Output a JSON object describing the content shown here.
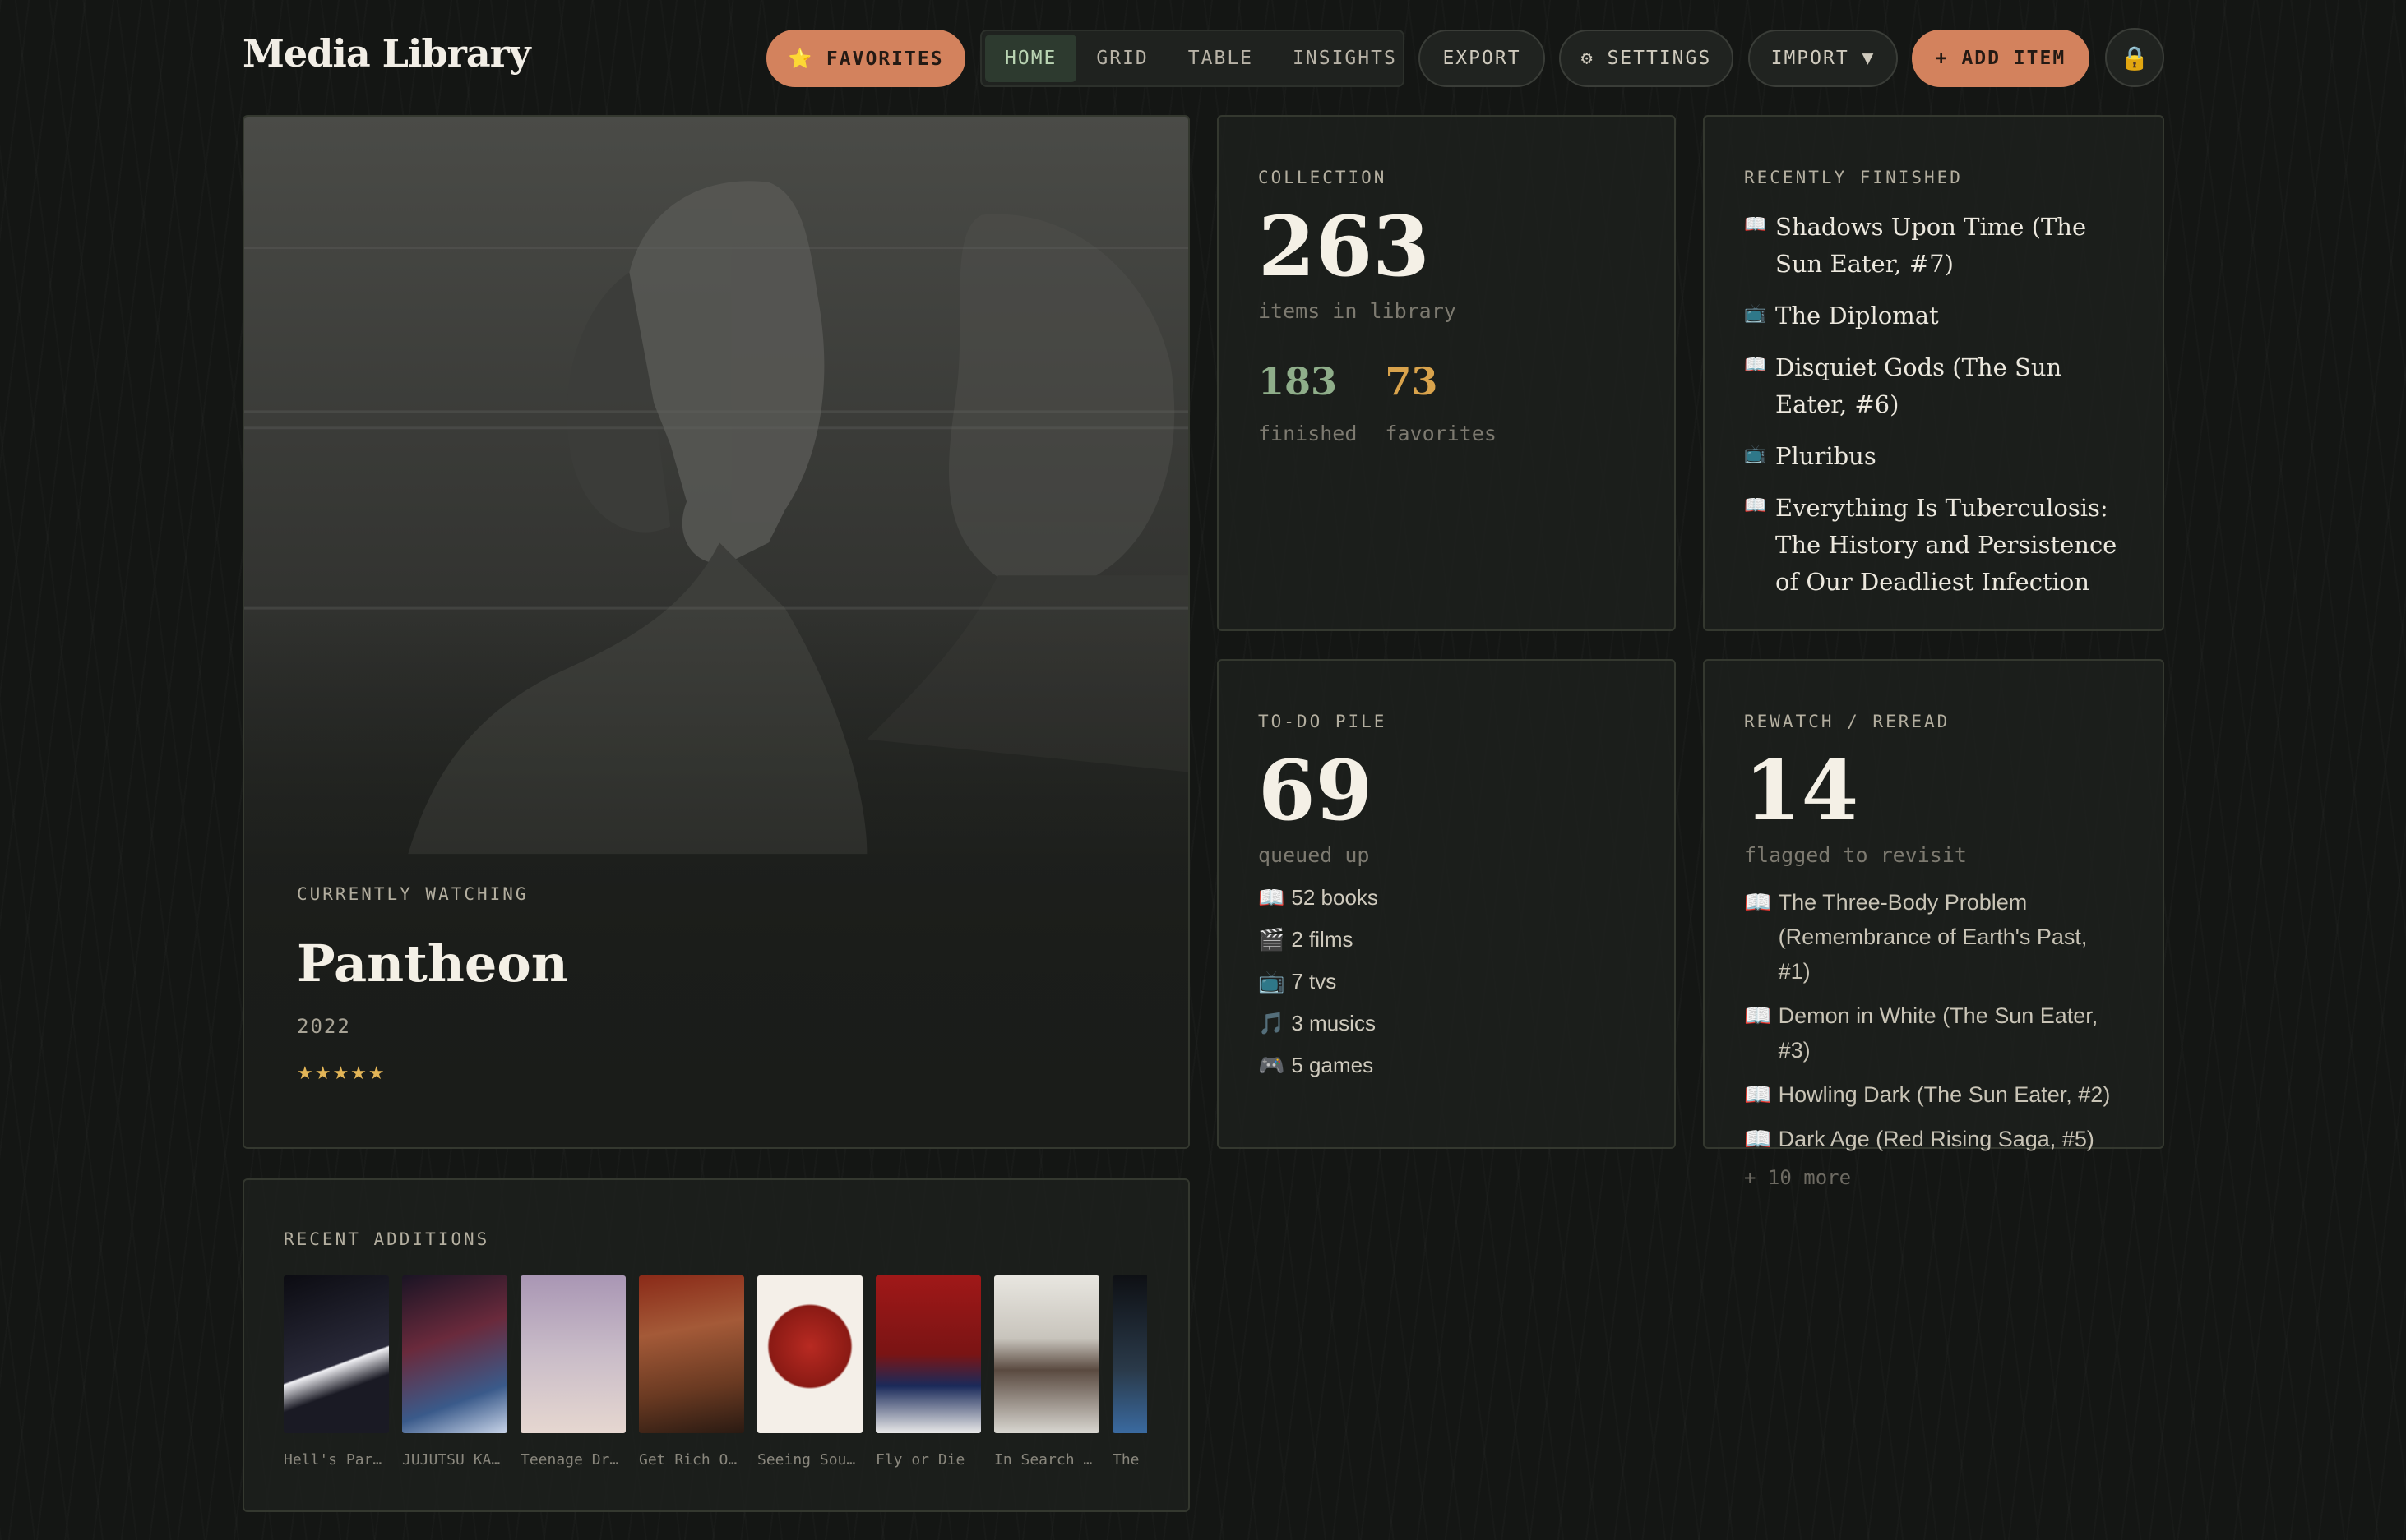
{
  "header": {
    "brand": "Media Library",
    "favorites_label": "⭐ FAVORITES",
    "tabs": [
      "HOME",
      "GRID",
      "TABLE",
      "INSIGHTS"
    ],
    "export_label": "EXPORT",
    "settings_label": "⚙ SETTINGS",
    "import_label": "IMPORT ▼",
    "add_label": "+ ADD ITEM",
    "lock_icon": "🔒"
  },
  "hero": {
    "label": "CURRENTLY WATCHING",
    "title": "Pantheon",
    "year": "2022",
    "stars": "★★★★★"
  },
  "collection": {
    "label": "COLLECTION",
    "total": "263",
    "total_sub": "items in library",
    "finished": "183",
    "finished_sub": "finished",
    "favorites": "73",
    "favorites_sub": "favorites"
  },
  "recently_finished": {
    "label": "RECENTLY FINISHED",
    "items": [
      {
        "icon": "📖",
        "title": "Shadows Upon Time (The Sun Eater, #7)"
      },
      {
        "icon": "📺",
        "title": "The Diplomat"
      },
      {
        "icon": "📖",
        "title": "Disquiet Gods (The Sun Eater, #6)"
      },
      {
        "icon": "📺",
        "title": "Pluribus"
      },
      {
        "icon": "📖",
        "title": "Everything Is Tuberculosis: The History and Persistence of Our Deadliest Infection"
      }
    ]
  },
  "todo": {
    "label": "TO-DO PILE",
    "total": "69",
    "sub": "queued up",
    "items": [
      {
        "icon": "📖",
        "text": "52 books"
      },
      {
        "icon": "🎬",
        "text": "2 films"
      },
      {
        "icon": "📺",
        "text": "7 tvs"
      },
      {
        "icon": "🎵",
        "text": "3 musics"
      },
      {
        "icon": "🎮",
        "text": "5 games"
      }
    ]
  },
  "rewatch": {
    "label": "REWATCH / REREAD",
    "total": "14",
    "sub": "flagged to revisit",
    "items": [
      {
        "icon": "📖",
        "title": "The Three-Body Problem (Remembrance of Earth's Past, #1)"
      },
      {
        "icon": "📖",
        "title": "Demon in White (The Sun Eater, #3)"
      },
      {
        "icon": "📖",
        "title": "Howling Dark (The Sun Eater, #2)"
      },
      {
        "icon": "📖",
        "title": "Dark Age (Red Rising Saga, #5)"
      }
    ],
    "more": "+ 10 more"
  },
  "recent": {
    "label": "RECENT ADDITIONS",
    "items": [
      {
        "caption": "Hell's Par…",
        "color": "#1a1a24"
      },
      {
        "caption": "JUJUTSU KA…",
        "color": "#5a2a3a"
      },
      {
        "caption": "Teenage Dr…",
        "color": "#b7a7b9"
      },
      {
        "caption": "Get Rich O…",
        "color": "#7a3a22"
      },
      {
        "caption": "Seeing Sou…",
        "color": "#e8e2da"
      },
      {
        "caption": "Fly or Die",
        "color": "#8a2424"
      },
      {
        "caption": "In Search …",
        "color": "#d8d6d0"
      },
      {
        "caption": "The",
        "color": "#2a3a4a"
      }
    ]
  }
}
